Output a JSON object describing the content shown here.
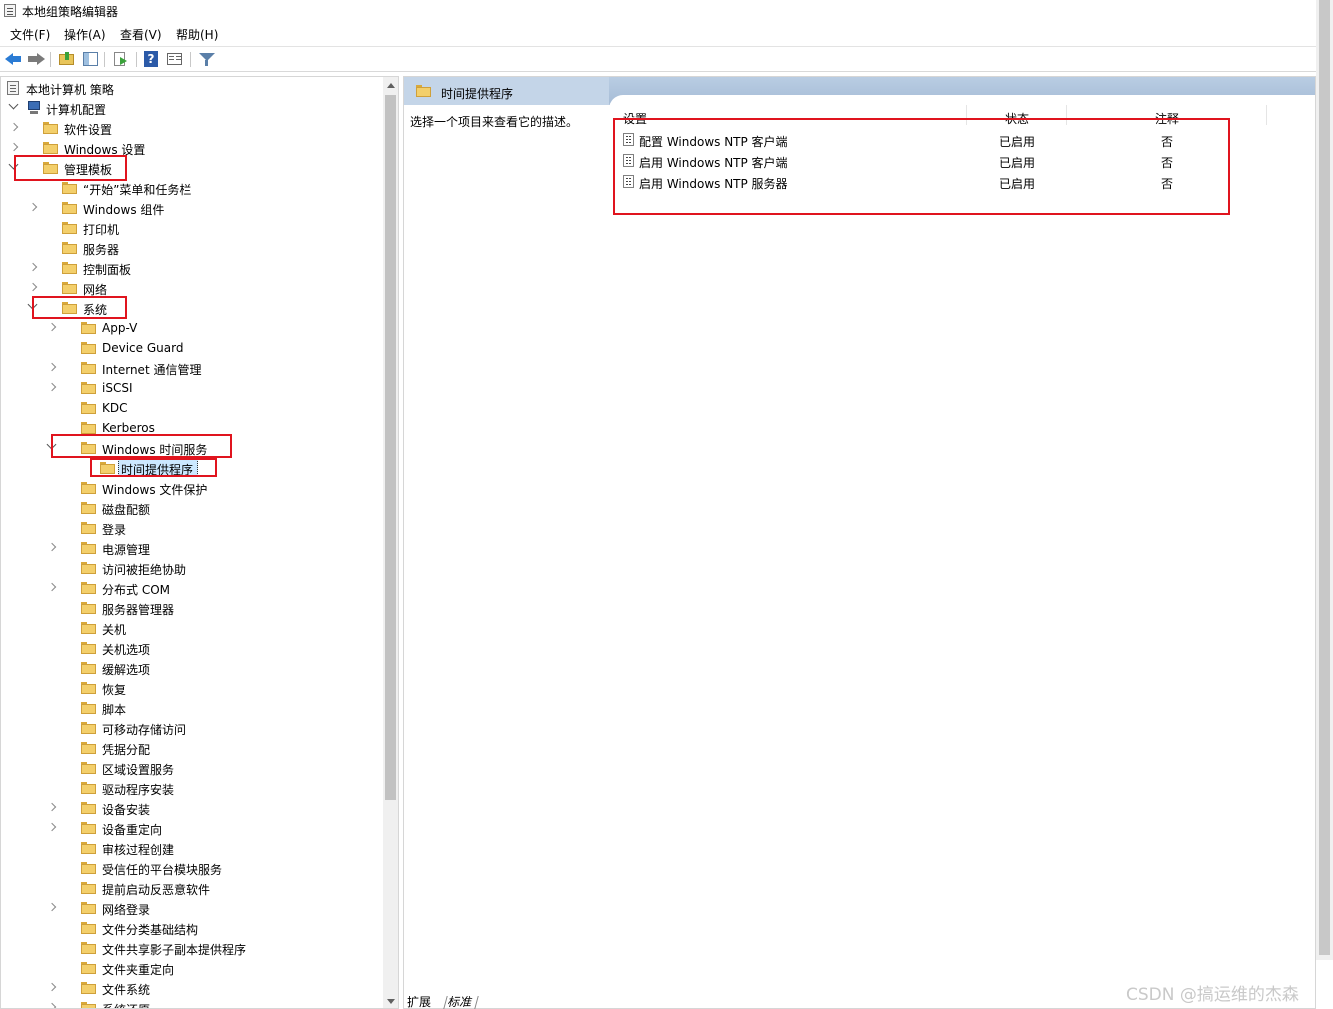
{
  "window": {
    "title": "本地组策略编辑器"
  },
  "menu": [
    "文件(F)",
    "操作(A)",
    "查看(V)",
    "帮助(H)"
  ],
  "toolbar": {
    "icons": [
      "back-arrow-icon",
      "forward-arrow-icon",
      "up-folder-icon",
      "show-hide-tree-icon",
      "export-list-icon",
      "help-icon",
      "properties-icon",
      "filter-icon"
    ]
  },
  "tree": {
    "root": "本地计算机 策略",
    "computer_config": "计算机配置",
    "items": [
      {
        "label": "软件设置"
      },
      {
        "label": "Windows 设置"
      },
      {
        "label": "管理模板"
      },
      {
        "label": "“开始”菜单和任务栏"
      },
      {
        "label": "Windows 组件"
      },
      {
        "label": "打印机"
      },
      {
        "label": "服务器"
      },
      {
        "label": "控制面板"
      },
      {
        "label": "网络"
      },
      {
        "label": "系统"
      },
      {
        "label": "App-V"
      },
      {
        "label": "Device Guard"
      },
      {
        "label": "Internet 通信管理"
      },
      {
        "label": "iSCSI"
      },
      {
        "label": "KDC"
      },
      {
        "label": "Kerberos"
      },
      {
        "label": "Windows 时间服务"
      },
      {
        "label": "时间提供程序"
      },
      {
        "label": "Windows 文件保护"
      },
      {
        "label": "磁盘配额"
      },
      {
        "label": "登录"
      },
      {
        "label": "电源管理"
      },
      {
        "label": "访问被拒绝协助"
      },
      {
        "label": "分布式 COM"
      },
      {
        "label": "服务器管理器"
      },
      {
        "label": "关机"
      },
      {
        "label": "关机选项"
      },
      {
        "label": "缓解选项"
      },
      {
        "label": "恢复"
      },
      {
        "label": "脚本"
      },
      {
        "label": "可移动存储访问"
      },
      {
        "label": "凭据分配"
      },
      {
        "label": "区域设置服务"
      },
      {
        "label": "驱动程序安装"
      },
      {
        "label": "设备安装"
      },
      {
        "label": "设备重定向"
      },
      {
        "label": "审核过程创建"
      },
      {
        "label": "受信任的平台模块服务"
      },
      {
        "label": "提前启动反恶意软件"
      },
      {
        "label": "网络登录"
      },
      {
        "label": "文件分类基础结构"
      },
      {
        "label": "文件共享影子副本提供程序"
      },
      {
        "label": "文件夹重定向"
      },
      {
        "label": "文件系统"
      },
      {
        "label": "系统还原"
      }
    ]
  },
  "details": {
    "header_title": "时间提供程序",
    "description": "选择一个项目来查看它的描述。",
    "columns": {
      "setting": "设置",
      "state": "状态",
      "comment": "注释"
    },
    "rows": [
      {
        "name": "配置 Windows NTP 客户端",
        "state": "已启用",
        "comment": "否"
      },
      {
        "name": "启用 Windows NTP 客户端",
        "state": "已启用",
        "comment": "否"
      },
      {
        "name": "启用 Windows NTP 服务器",
        "state": "已启用",
        "comment": "否"
      }
    ]
  },
  "bottom_tabs": [
    "扩展",
    "标准"
  ],
  "watermark": "CSDN @搞运维的杰森",
  "colors": {
    "highlight_box": "#e0141e",
    "selection": "#cce8ff",
    "header_band": "#b9cde3",
    "folder": "#f3cf6b"
  }
}
